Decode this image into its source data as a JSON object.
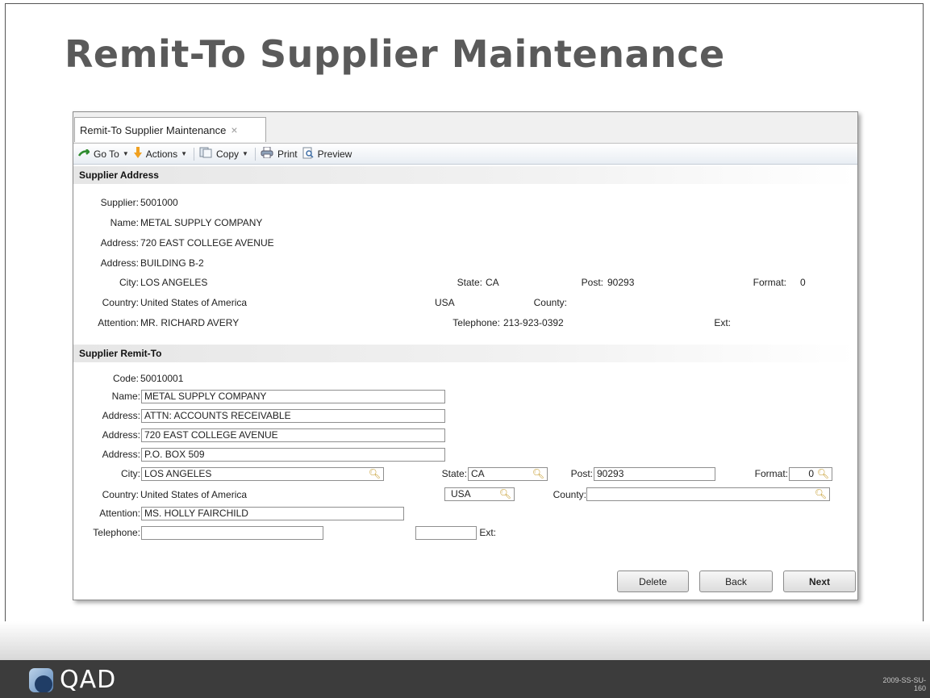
{
  "slide": {
    "title": "Remit-To Supplier Maintenance",
    "brand": "QAD",
    "code_line1": "2009-SS-SU-",
    "code_line2": "160"
  },
  "window": {
    "tab_label": "Remit-To Supplier Maintenance",
    "tab_close": "×"
  },
  "toolbar": {
    "goto": "Go To",
    "actions": "Actions",
    "copy": "Copy",
    "print": "Print",
    "preview": "Preview"
  },
  "supplier_address": {
    "header": "Supplier Address",
    "supplier_label": "Supplier:",
    "supplier": "5001000",
    "name_label": "Name:",
    "name": "METAL SUPPLY COMPANY",
    "address1_label": "Address:",
    "address1": "720 EAST COLLEGE AVENUE",
    "address2_label": "Address:",
    "address2": "BUILDING B-2",
    "city_label": "City:",
    "city": "LOS ANGELES",
    "state_label": "State:",
    "state": "CA",
    "post_label": "Post:",
    "post": "90293",
    "format_label": "Format:",
    "format": "0",
    "country_label": "Country:",
    "country": "United States of America",
    "country_code": "USA",
    "county_label": "County:",
    "attention_label": "Attention:",
    "attention": "MR. RICHARD AVERY",
    "telephone_label": "Telephone:",
    "telephone": "213-923-0392",
    "ext_label": "Ext:"
  },
  "remit_to": {
    "header": "Supplier Remit-To",
    "code_label": "Code:",
    "code": "50010001",
    "name_label": "Name:",
    "name": "METAL SUPPLY COMPANY",
    "address1_label": "Address:",
    "address1": "ATTN: ACCOUNTS RECEIVABLE",
    "address2_label": "Address:",
    "address2": "720 EAST COLLEGE AVENUE",
    "address3_label": "Address:",
    "address3": "P.O. BOX 509",
    "city_label": "City:",
    "city": "LOS ANGELES",
    "state_label": "State:",
    "state": "CA",
    "post_label": "Post:",
    "post": "90293",
    "format_label": "Format:",
    "format": "0",
    "country_label": "Country:",
    "country": "United States of America",
    "country_code": "USA",
    "county_label": "County:",
    "county": "",
    "attention_label": "Attention:",
    "attention": "MS. HOLLY FAIRCHILD",
    "telephone_label": "Telephone:",
    "telephone": "",
    "ext_label": "Ext:",
    "ext": ""
  },
  "buttons": {
    "delete": "Delete",
    "back": "Back",
    "next": "Next"
  },
  "colors": {
    "title": "#5a5a5a",
    "footer": "#3c3c3c",
    "lookup_icon": "#c49a2a"
  },
  "icons": [
    "goto-icon",
    "actions-icon",
    "copy-icon",
    "print-icon",
    "preview-icon",
    "lookup-icon",
    "close-icon",
    "qad-logo"
  ]
}
